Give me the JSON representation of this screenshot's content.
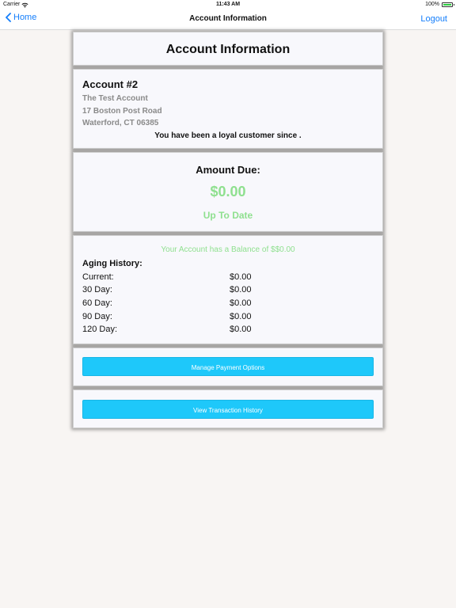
{
  "status_bar": {
    "carrier": "Carrier",
    "time": "11:43 AM",
    "battery": "100%"
  },
  "nav": {
    "back_label": "Home",
    "title": "Account Information",
    "logout_label": "Logout"
  },
  "title_card": {
    "heading": "Account Information"
  },
  "account": {
    "number": "Account #2",
    "name": "The Test Account",
    "street": "17 Boston Post Road",
    "city": "Waterford, CT 06385",
    "loyalty": "You have been a loyal customer since ."
  },
  "amount_due": {
    "label": "Amount Due:",
    "amount": "$0.00",
    "status": "Up To Date"
  },
  "aging": {
    "balance_message": "Your Account has a Balance of $$0.00",
    "heading": "Aging History:",
    "rows": [
      {
        "label": "Current:",
        "value": "$0.00"
      },
      {
        "label": "30 Day:",
        "value": "$0.00"
      },
      {
        "label": "60 Day:",
        "value": "$0.00"
      },
      {
        "label": "90 Day:",
        "value": "$0.00"
      },
      {
        "label": "120 Day:",
        "value": "$0.00"
      }
    ]
  },
  "buttons": {
    "manage_payment": "Manage Payment Options",
    "view_transactions": "View Transaction History"
  },
  "colors": {
    "accent": "#147efb",
    "button": "#1ec8fa",
    "positive": "#8fe08f",
    "background": "#f8f5f3"
  }
}
